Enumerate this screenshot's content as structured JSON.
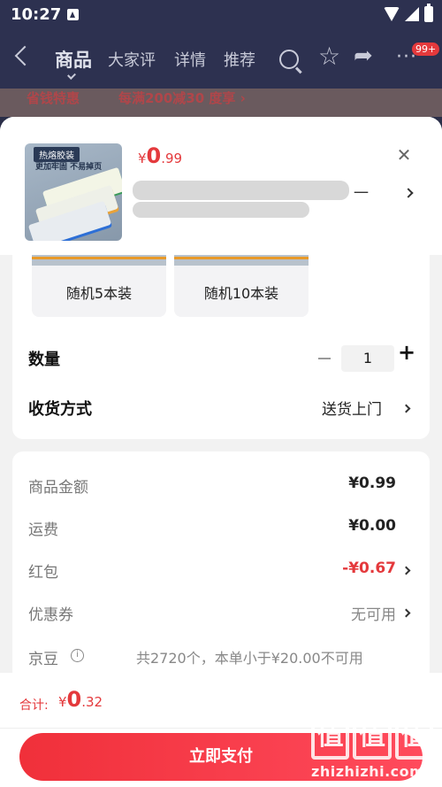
{
  "status_bar": {
    "time": "10:27"
  },
  "nav": {
    "tabs": [
      {
        "label": "商品",
        "active": true
      },
      {
        "label": "大家评"
      },
      {
        "label": "详情"
      },
      {
        "label": "推荐"
      }
    ],
    "badge": "99+"
  },
  "background_promo": {
    "left": "省钱特惠",
    "right": "每满200减30 度享 ›"
  },
  "product": {
    "price_symbol": "¥",
    "price_int": "0",
    "price_dec": ".99",
    "title_visible_tail": "一",
    "thumbnail": {
      "tag": "热熔胶装",
      "caption": "更加牢固 不易掉页"
    }
  },
  "variants": [
    {
      "label": "随机5本装"
    },
    {
      "label": "随机10本装"
    }
  ],
  "quantity": {
    "label": "数量",
    "value": "1",
    "minus": "−",
    "plus": "+"
  },
  "delivery": {
    "label": "收货方式",
    "value": "送货上门"
  },
  "fees": [
    {
      "label": "商品金额",
      "value": "¥0.99"
    },
    {
      "label": "运费",
      "value": "¥0.00"
    },
    {
      "label": "红包",
      "value": "-¥0.67"
    },
    {
      "label": "优惠券",
      "value": "无可用"
    },
    {
      "label": "京豆",
      "value": "共2720个，本单小于¥20.00不可用"
    }
  ],
  "footer": {
    "total_label": "合计:",
    "total_symbol": "¥",
    "total_int": "0",
    "total_dec": ".32",
    "pay_button": "立即支付"
  },
  "watermark": {
    "logo_chars": [
      "值",
      "值",
      "值"
    ],
    "site": "zhizhizhi.com"
  },
  "colors": {
    "accent": "#e4393c",
    "nav_bg": "#2d3150"
  }
}
